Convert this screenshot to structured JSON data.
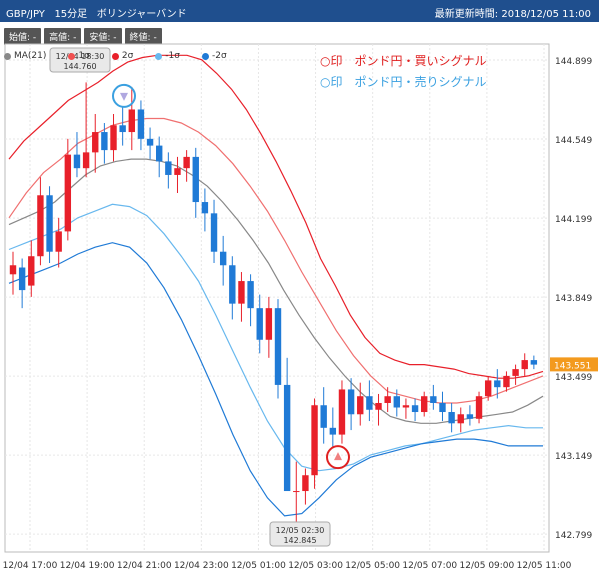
{
  "header": {
    "pair": "GBP/JPY",
    "interval": "15分足",
    "indicator": "ボリンジャーバンド",
    "updated_label": "最新更新時間:",
    "updated_value": "2018/12/05 11:00"
  },
  "ohlc": [
    {
      "label": "始値:",
      "value": "-"
    },
    {
      "label": "高値:",
      "value": "-"
    },
    {
      "label": "安値:",
      "value": "-"
    },
    {
      "label": "終値:",
      "value": "-"
    }
  ],
  "legend": [
    {
      "label": "MA(21)",
      "color": "#888888"
    },
    {
      "label": "1σ",
      "color": "#f05050"
    },
    {
      "label": "2σ",
      "color": "#e8202a"
    },
    {
      "label": "-1σ",
      "color": "#68b8ee"
    },
    {
      "label": "-2σ",
      "color": "#1f7ad6"
    }
  ],
  "signals": {
    "buy": "○印　ポンド円・買いシグナル",
    "sell": "○印　ポンド円・売りシグナル",
    "buy_color": "#e02020",
    "sell_color": "#3aa0e0"
  },
  "chart_data": {
    "type": "candlestick",
    "ylim": [
      142.72,
      144.97
    ],
    "y_ticks": [
      "144.899",
      "144.549",
      "144.199",
      "143.849",
      "143.499",
      "143.149",
      "142.799"
    ],
    "x_ticks": [
      "12/04 17:00",
      "12/04 19:00",
      "12/04 21:00",
      "12/04 23:00",
      "12/05 01:00",
      "12/05 03:00",
      "12/05 05:00",
      "12/05 07:00",
      "12/05 09:00",
      "12/05 11:00"
    ],
    "current_price": "143.551",
    "high_annotation": {
      "time": "12/04 18:30",
      "value": "144.760"
    },
    "low_annotation": {
      "time": "12/05 02:30",
      "value": "142.845"
    },
    "candles": [
      {
        "o": 143.95,
        "h": 144.05,
        "l": 143.86,
        "c": 143.99
      },
      {
        "o": 143.98,
        "h": 144.02,
        "l": 143.8,
        "c": 143.88
      },
      {
        "o": 143.9,
        "h": 144.1,
        "l": 143.85,
        "c": 144.03
      },
      {
        "o": 144.03,
        "h": 144.38,
        "l": 143.99,
        "c": 144.3
      },
      {
        "o": 144.3,
        "h": 144.34,
        "l": 144.0,
        "c": 144.05
      },
      {
        "o": 144.05,
        "h": 144.2,
        "l": 143.98,
        "c": 144.14
      },
      {
        "o": 144.14,
        "h": 144.55,
        "l": 144.1,
        "c": 144.48
      },
      {
        "o": 144.48,
        "h": 144.58,
        "l": 144.38,
        "c": 144.42
      },
      {
        "o": 144.42,
        "h": 144.8,
        "l": 144.38,
        "c": 144.49
      },
      {
        "o": 144.49,
        "h": 144.66,
        "l": 144.4,
        "c": 144.58
      },
      {
        "o": 144.58,
        "h": 144.62,
        "l": 144.44,
        "c": 144.5
      },
      {
        "o": 144.5,
        "h": 144.66,
        "l": 144.45,
        "c": 144.61
      },
      {
        "o": 144.61,
        "h": 144.69,
        "l": 144.52,
        "c": 144.58
      },
      {
        "o": 144.58,
        "h": 144.78,
        "l": 144.5,
        "c": 144.68
      },
      {
        "o": 144.68,
        "h": 144.72,
        "l": 144.5,
        "c": 144.55
      },
      {
        "o": 144.55,
        "h": 144.6,
        "l": 144.46,
        "c": 144.52
      },
      {
        "o": 144.52,
        "h": 144.56,
        "l": 144.38,
        "c": 144.45
      },
      {
        "o": 144.45,
        "h": 144.49,
        "l": 144.33,
        "c": 144.39
      },
      {
        "o": 144.39,
        "h": 144.47,
        "l": 144.31,
        "c": 144.42
      },
      {
        "o": 144.42,
        "h": 144.5,
        "l": 144.36,
        "c": 144.47
      },
      {
        "o": 144.47,
        "h": 144.51,
        "l": 144.2,
        "c": 144.27
      },
      {
        "o": 144.27,
        "h": 144.33,
        "l": 144.14,
        "c": 144.22
      },
      {
        "o": 144.22,
        "h": 144.28,
        "l": 144.0,
        "c": 144.05
      },
      {
        "o": 144.05,
        "h": 144.12,
        "l": 143.9,
        "c": 143.99
      },
      {
        "o": 143.99,
        "h": 144.03,
        "l": 143.75,
        "c": 143.82
      },
      {
        "o": 143.82,
        "h": 143.96,
        "l": 143.74,
        "c": 143.92
      },
      {
        "o": 143.92,
        "h": 143.95,
        "l": 143.72,
        "c": 143.8
      },
      {
        "o": 143.8,
        "h": 143.86,
        "l": 143.6,
        "c": 143.66
      },
      {
        "o": 143.66,
        "h": 143.85,
        "l": 143.58,
        "c": 143.8
      },
      {
        "o": 143.8,
        "h": 143.84,
        "l": 143.4,
        "c": 143.46
      },
      {
        "o": 143.46,
        "h": 143.58,
        "l": 143.15,
        "c": 142.99
      },
      {
        "o": 142.99,
        "h": 143.12,
        "l": 142.85,
        "c": 142.99
      },
      {
        "o": 142.99,
        "h": 143.09,
        "l": 142.93,
        "c": 143.06
      },
      {
        "o": 143.06,
        "h": 143.4,
        "l": 143.0,
        "c": 143.37
      },
      {
        "o": 143.37,
        "h": 143.45,
        "l": 143.2,
        "c": 143.27
      },
      {
        "o": 143.27,
        "h": 143.36,
        "l": 143.18,
        "c": 143.24
      },
      {
        "o": 143.24,
        "h": 143.48,
        "l": 143.2,
        "c": 143.44
      },
      {
        "o": 143.44,
        "h": 143.49,
        "l": 143.26,
        "c": 143.33
      },
      {
        "o": 143.33,
        "h": 143.47,
        "l": 143.28,
        "c": 143.41
      },
      {
        "o": 143.41,
        "h": 143.48,
        "l": 143.3,
        "c": 143.35
      },
      {
        "o": 143.35,
        "h": 143.42,
        "l": 143.28,
        "c": 143.38
      },
      {
        "o": 143.38,
        "h": 143.45,
        "l": 143.34,
        "c": 143.41
      },
      {
        "o": 143.41,
        "h": 143.44,
        "l": 143.32,
        "c": 143.36
      },
      {
        "o": 143.36,
        "h": 143.4,
        "l": 143.31,
        "c": 143.37
      },
      {
        "o": 143.37,
        "h": 143.4,
        "l": 143.3,
        "c": 143.34
      },
      {
        "o": 143.34,
        "h": 143.43,
        "l": 143.32,
        "c": 143.41
      },
      {
        "o": 143.41,
        "h": 143.46,
        "l": 143.35,
        "c": 143.38
      },
      {
        "o": 143.38,
        "h": 143.43,
        "l": 143.3,
        "c": 143.34
      },
      {
        "o": 143.34,
        "h": 143.38,
        "l": 143.25,
        "c": 143.29
      },
      {
        "o": 143.29,
        "h": 143.36,
        "l": 143.25,
        "c": 143.33
      },
      {
        "o": 143.33,
        "h": 143.37,
        "l": 143.28,
        "c": 143.31
      },
      {
        "o": 143.31,
        "h": 143.43,
        "l": 143.29,
        "c": 143.41
      },
      {
        "o": 143.41,
        "h": 143.5,
        "l": 143.39,
        "c": 143.48
      },
      {
        "o": 143.48,
        "h": 143.53,
        "l": 143.4,
        "c": 143.45
      },
      {
        "o": 143.45,
        "h": 143.52,
        "l": 143.43,
        "c": 143.5
      },
      {
        "o": 143.5,
        "h": 143.55,
        "l": 143.46,
        "c": 143.53
      },
      {
        "o": 143.53,
        "h": 143.6,
        "l": 143.5,
        "c": 143.57
      },
      {
        "o": 143.57,
        "h": 143.59,
        "l": 143.53,
        "c": 143.55
      }
    ],
    "bands": {
      "upper2": [
        144.46,
        144.54,
        144.6,
        144.66,
        144.72,
        144.76,
        144.8,
        144.85,
        144.89,
        144.91,
        144.92,
        144.92,
        144.92,
        144.9,
        144.84,
        144.77,
        144.68,
        144.57,
        144.45,
        144.32,
        144.18,
        144.02,
        143.9,
        143.77,
        143.67,
        143.6,
        143.57,
        143.55,
        143.55,
        143.54,
        143.53,
        143.51,
        143.5,
        143.49,
        143.49,
        143.5,
        143.52
      ],
      "upper1": [
        144.2,
        144.31,
        144.4,
        144.46,
        144.53,
        144.57,
        144.61,
        144.63,
        144.64,
        144.64,
        144.62,
        144.58,
        144.52,
        144.44,
        144.34,
        144.23,
        144.1,
        143.96,
        143.83,
        143.7,
        143.59,
        143.5,
        143.43,
        143.41,
        143.39,
        143.38,
        143.38,
        143.39,
        143.41,
        143.44,
        143.47,
        143.5
      ],
      "ma": [
        144.17,
        144.2,
        144.23,
        144.27,
        144.33,
        144.39,
        144.43,
        144.45,
        144.46,
        144.46,
        144.45,
        144.43,
        144.39,
        144.34,
        144.27,
        144.19,
        144.1,
        144.0,
        143.88,
        143.77,
        143.67,
        143.58,
        143.5,
        143.43,
        143.37,
        143.32,
        143.3,
        143.29,
        143.29,
        143.3,
        143.31,
        143.32,
        143.33,
        143.34,
        143.37,
        143.41
      ],
      "lower1": [
        144.06,
        144.09,
        144.12,
        144.15,
        144.2,
        144.23,
        144.26,
        144.25,
        144.21,
        144.13,
        144.03,
        143.92,
        143.77,
        143.61,
        143.45,
        143.3,
        143.18,
        143.1,
        143.08,
        143.09,
        143.11,
        143.15,
        143.17,
        143.19,
        143.2,
        143.22,
        143.24,
        143.26,
        143.27,
        143.28,
        143.27,
        143.27
      ],
      "lower2": [
        143.91,
        143.94,
        143.97,
        144.0,
        144.04,
        144.07,
        144.09,
        144.07,
        144.0,
        143.89,
        143.75,
        143.59,
        143.42,
        143.24,
        143.08,
        142.96,
        142.88,
        142.89,
        142.96,
        143.04,
        143.1,
        143.14,
        143.16,
        143.18,
        143.2,
        143.21,
        143.22,
        143.22,
        143.21,
        143.19,
        143.19,
        143.19
      ]
    },
    "buy_marker_value": 143.14,
    "sell_marker_value": 144.74
  }
}
